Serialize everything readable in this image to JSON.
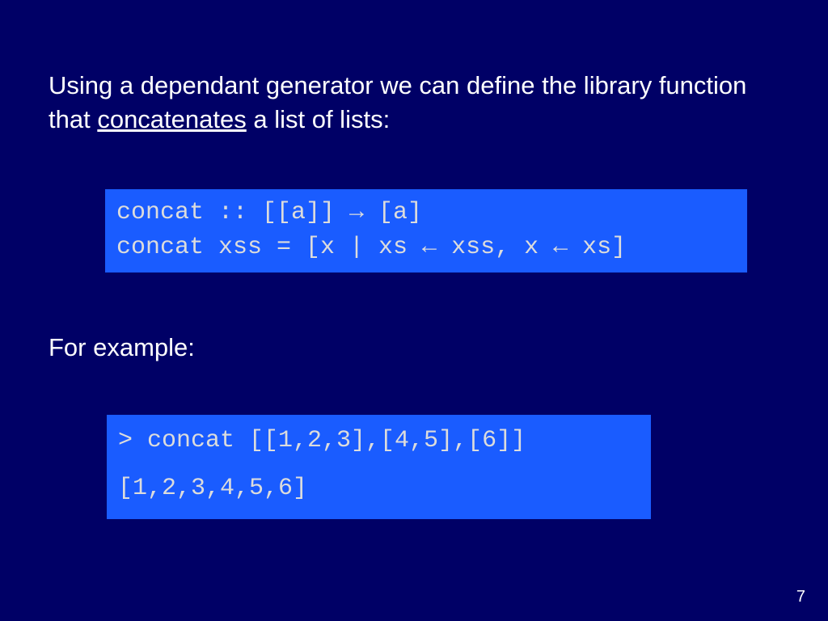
{
  "intro": {
    "part1": "Using a dependant generator we can define the library function that ",
    "underlined": "concatenates",
    "part2": " a list of lists:"
  },
  "definition": {
    "line1": "concat :: [[a]] → [a]",
    "line2": "concat xss = [x | xs ← xss, x ← xs]"
  },
  "for_example_label": "For example:",
  "example": {
    "input": "> concat [[1,2,3],[4,5],[6]]",
    "output": "[1,2,3,4,5,6]"
  },
  "page_number": "7"
}
